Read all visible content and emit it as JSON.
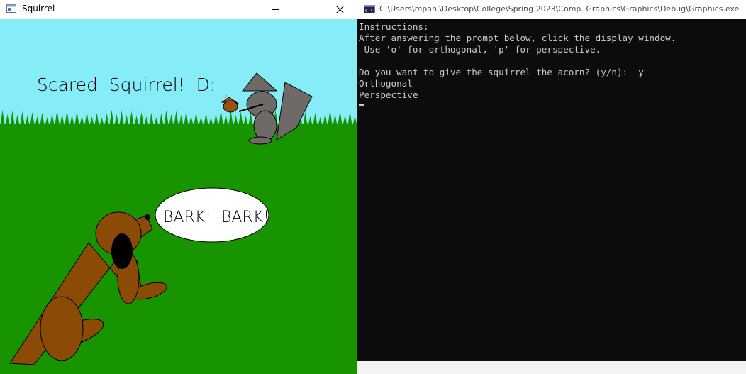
{
  "squirrel_window": {
    "title": "Squirrel",
    "scene_heading": "Scared  Squirrel!  D:",
    "speech_bubble": "BARK!  BARK!",
    "colors": {
      "sky": "#86ecf7",
      "grass": "#189400",
      "dog": "#8c4a07",
      "squirrel": "#706a66",
      "acorn": "#9a5212"
    }
  },
  "console_window": {
    "title": "C:\\Users\\mpani\\Desktop\\College\\Spring 2023\\Comp. Graphics\\Graphics\\Debug\\Graphics.exe",
    "lines": [
      "Instructions:",
      "After answering the prompt below, click the display window.",
      " Use 'o' for orthogonal, 'p' for perspective.",
      "",
      "Do you want to give the squirrel the acorn? (y/n):  y",
      "Orthogonal",
      "Perspective"
    ]
  }
}
